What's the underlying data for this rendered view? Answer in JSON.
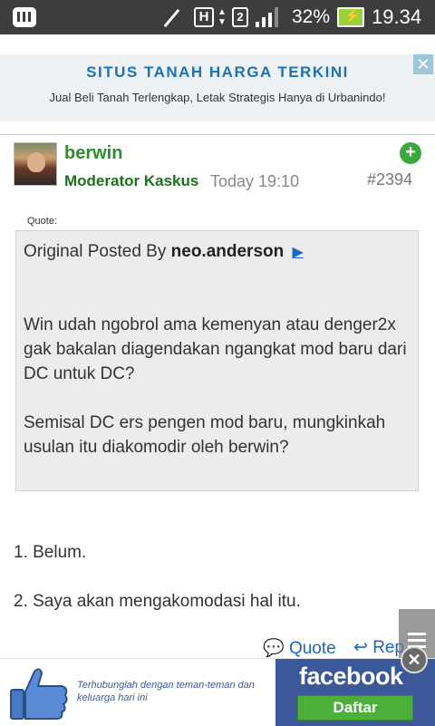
{
  "status_bar": {
    "h_label": "H",
    "network_type": "2",
    "battery_pct": "32%",
    "time": "19.34"
  },
  "top_ad": {
    "title": "SITUS TANAH HARGA TERKINI",
    "subtitle": "Jual Beli Tanah Terlengkap, Letak Strategis Hanya di Urbanindo!",
    "close_label": "✕"
  },
  "post": {
    "username": "berwin",
    "user_title": "Moderator Kaskus",
    "time": "Today 19:10",
    "post_number": "#2394",
    "quote_label": "Quote:",
    "quote": {
      "prefix": "Original Posted By",
      "author": "neo.anderson",
      "paragraph1": "Win udah ngobrol ama kemenyan atau denger2x gak bakalan diagendakan ngangkat mod baru dari DC untuk DC?",
      "paragraph2": "Semisal DC ers pengen mod baru, mungkinkah usulan itu diakomodir oleh berwin?"
    },
    "lines": [
      "1. Belum.",
      "2. Saya akan mengakomodasi hal itu."
    ],
    "actions": {
      "quote": "Quote",
      "reply": "Rep"
    }
  },
  "bottom_ad": {
    "text": "Terhubunglah dengan teman-teman dan keluarga hari ini",
    "brand": "facebook",
    "button": "Daftar",
    "close_label": "✕"
  },
  "colors": {
    "accent_blue": "#1a66c4",
    "user_green": "#2e8b2e",
    "facebook_blue": "#3b5998"
  }
}
